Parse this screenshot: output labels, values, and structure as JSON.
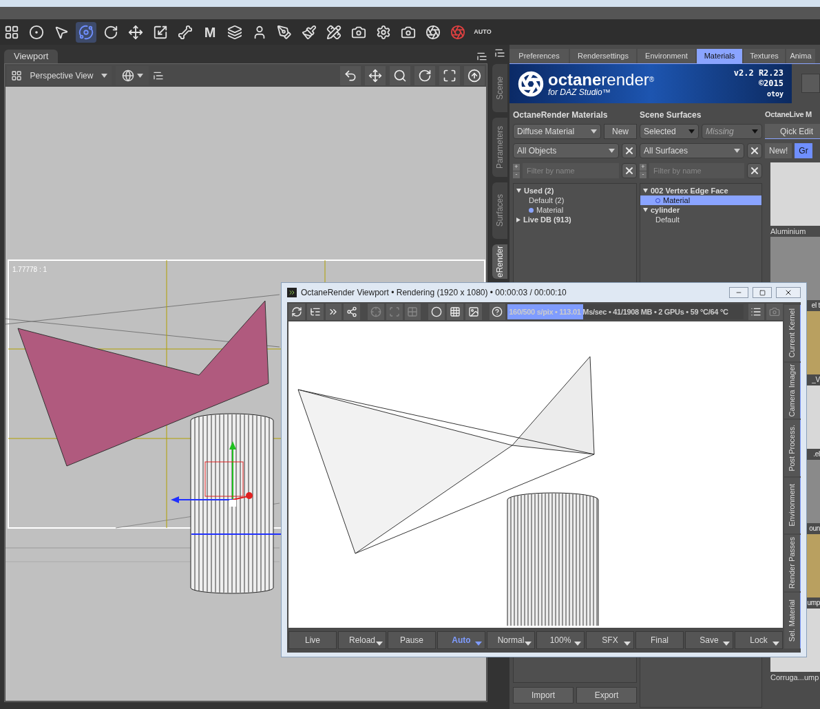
{
  "toolbar": {
    "tools": [
      {
        "selected": false
      },
      {
        "selected": false
      },
      {
        "selected": false
      },
      {
        "selected": true
      },
      {
        "selected": false
      },
      {
        "selected": false
      },
      {
        "selected": false
      },
      {
        "selected": false
      },
      {
        "selected": false,
        "label": "M"
      },
      {
        "selected": false
      },
      {
        "selected": false
      },
      {
        "selected": false
      },
      {
        "selected": false
      },
      {
        "selected": false
      },
      {
        "selected": false
      },
      {
        "selected": false
      },
      {
        "selected": false
      },
      {
        "selected": false
      },
      {
        "selected": false
      },
      {
        "selected": false,
        "label": "AUTO"
      }
    ]
  },
  "viewport": {
    "tab": "Viewport",
    "view_select": "Perspective View",
    "aspect": "1.77778 : 1"
  },
  "side_tabs": [
    {
      "label": "Scene",
      "selected": false
    },
    {
      "label": "Parameters",
      "selected": false
    },
    {
      "label": "Surfaces",
      "selected": false
    },
    {
      "label": "eRender",
      "selected": true
    }
  ],
  "panel_tabs": [
    {
      "label": "Preferences",
      "selected": false
    },
    {
      "label": "Rendersettings",
      "selected": false
    },
    {
      "label": "Environment",
      "selected": false
    },
    {
      "label": "Materials",
      "selected": true
    },
    {
      "label": "Textures",
      "selected": false
    },
    {
      "label": "Anima",
      "selected": false
    }
  ],
  "banner": {
    "brand_bold": "octane",
    "brand_light": "render",
    "registered": "®",
    "subtitle": "for DAZ Studio™",
    "version": "v2.2",
    "release": "R2.23",
    "copyright": "©2015",
    "company": "otoy"
  },
  "materials": {
    "heading": "OctaneRender Materials",
    "type_select": "Diffuse Material",
    "new_button": "New",
    "object_select": "All Objects",
    "filter": {
      "placeholder": "Filter by name",
      "expand": "+",
      "collapse": "-"
    },
    "tree": [
      {
        "label": "Used (2)",
        "expanded": true,
        "children": [
          {
            "label": "Default (2)"
          },
          {
            "label": "Material",
            "dot": true
          }
        ]
      },
      {
        "label": "Live DB (913)",
        "expanded": false
      }
    ],
    "import_button": "Import",
    "export_button": "Export"
  },
  "surfaces": {
    "heading": "Scene Surfaces",
    "scope_select": "Selected",
    "missing_select": {
      "label": "Missing",
      "disabled": true
    },
    "surface_select": "All Surfaces",
    "filter": {
      "placeholder": "Filter by name",
      "expand": "+",
      "collapse": "-"
    },
    "tree": [
      {
        "label": "002 Vertex Edge Face",
        "expanded": true,
        "children": [
          {
            "label": "Material",
            "selected": true,
            "dot": true
          }
        ]
      },
      {
        "label": "cylinder",
        "expanded": true,
        "children": [
          {
            "label": "Default",
            "selected": false
          }
        ]
      }
    ]
  },
  "live": {
    "heading": "OctaneLive M",
    "quick_edit": "Qick Edit",
    "buttons": [
      {
        "label": "New!",
        "selected": false
      },
      {
        "label": "Gr",
        "selected": true
      }
    ],
    "thumbnails": [
      {
        "label": "Aluminium",
        "covered": false
      },
      {
        "label": "el t",
        "covered": true
      },
      {
        "label": "_V",
        "covered": true
      },
      {
        "label": ".el",
        "covered": true
      },
      {
        "label": "oun",
        "covered": true
      },
      {
        "label": "ump",
        "covered": true
      },
      {
        "label": "Corruga...ump",
        "covered": false
      }
    ]
  },
  "render_window": {
    "title": "OctaneRender Viewport • Rendering (1920 x 1080) • 00:00:03 / 00:00:10",
    "status": "160/500 s/pix • 113.01 Ms/sec • 41/1908 MB • 2 GPUs • 59 °C/64 °C",
    "level": 0.32,
    "side_tabs": [
      {
        "label": "Current Kernel"
      },
      {
        "label": "Camera Imager"
      },
      {
        "label": "Post Process."
      },
      {
        "label": "Environment"
      },
      {
        "label": "Render Passes"
      },
      {
        "label": "Sel. Material"
      }
    ],
    "buttons": [
      {
        "label": "Live",
        "dropdown": false,
        "selected": false
      },
      {
        "label": "Reload",
        "dropdown": true,
        "selected": false
      },
      {
        "label": "Pause",
        "dropdown": false,
        "selected": false
      },
      {
        "label": "Auto",
        "dropdown": true,
        "selected": true
      },
      {
        "label": "Normal",
        "dropdown": true,
        "selected": false
      },
      {
        "label": "100%",
        "dropdown": true,
        "selected": false
      },
      {
        "label": "SFX",
        "dropdown": true,
        "selected": false
      },
      {
        "label": "Final",
        "dropdown": false,
        "selected": false
      },
      {
        "label": "Save",
        "dropdown": true,
        "selected": false
      },
      {
        "label": "Lock",
        "dropdown": true,
        "selected": false
      }
    ]
  }
}
